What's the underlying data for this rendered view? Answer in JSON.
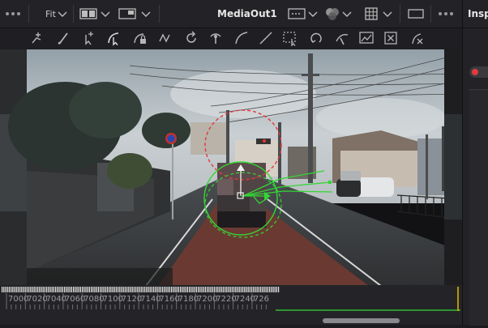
{
  "viewer": {
    "zoom_label": "Fit",
    "title": "MediaOut1",
    "right_tab": "Insp"
  },
  "toolbar": {
    "tools": [
      "polyline-mask-icon",
      "paint-brush-icon",
      "add-point-icon",
      "select-point-icon",
      "lock-point-icon",
      "smooth-icon",
      "rotate-icon",
      "transform-icon",
      "curve-icon",
      "line-icon",
      "rect-select-icon",
      "loop-icon",
      "pen-pressure-icon",
      "image-frame-icon",
      "close-square-icon",
      "delete-point-icon"
    ]
  },
  "timeline": {
    "ticks": [
      "7000",
      "7020",
      "7040",
      "7060",
      "7080",
      "7100",
      "7120",
      "7140",
      "7160",
      "7180",
      "7200",
      "7220",
      "7240",
      "726"
    ]
  },
  "colors": {
    "accent_green": "#33d633",
    "mask_red": "#e23a3a",
    "playhead": "#e6b800"
  }
}
